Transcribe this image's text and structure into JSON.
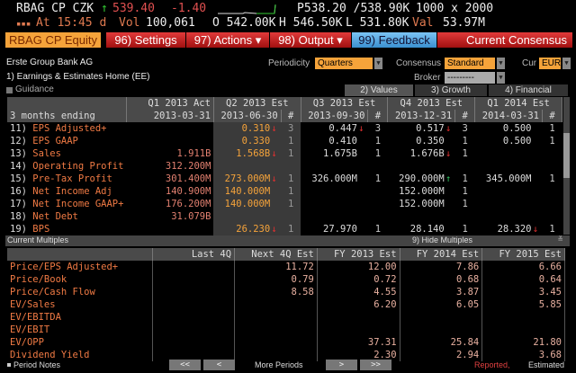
{
  "quote": {
    "ticker": "RBAG CP CZK",
    "last": "539.40",
    "change": "-1.40",
    "bid_ask": "P538.20 /538.90K",
    "size": "1000 x 2000",
    "time": "At 15:45 d",
    "vol_label": "Vol",
    "vol": "100,061",
    "open": "O 542.00K",
    "high": "H 546.50K",
    "low": "L 531.80K",
    "val_label": "Val",
    "val": "53.97M"
  },
  "toolbar": {
    "security": "RBAG CP Equity",
    "settings": "96) Settings",
    "actions": "97) Actions ▾",
    "output": "98) Output ▾",
    "feedback": "99) Feedback",
    "title": "Current Consensus"
  },
  "company": "Erste Group Bank AG",
  "home_link": "1) Earnings & Estimates Home (EE)",
  "filters": {
    "periodicity_label": "Periodicity",
    "periodicity": "Quarters",
    "consensus_label": "Consensus",
    "consensus": "Standard",
    "cur_label": "Cur",
    "cur": "EUR",
    "broker_label": "Broker",
    "broker": "---------"
  },
  "guidance": "Guidance",
  "tabs": [
    "2) Values",
    "3) Growth",
    "4) Financial"
  ],
  "estimates": {
    "headers": [
      "",
      "Q1 2013 Act",
      "Q2 2013 Est",
      "Q3 2013 Est",
      "Q4 2013 Est",
      "Q1 2014 Est"
    ],
    "subheaders": [
      "3 months ending",
      "2013-03-31",
      "2013-06-30",
      "#",
      "2013-09-30",
      "#",
      "2013-12-31",
      "#",
      "2014-03-31",
      "#"
    ],
    "rows": [
      {
        "n": "11)",
        "label": "EPS Adjusted+",
        "q1a": "",
        "q2": "0.310",
        "q2d": "down",
        "q2n": "3",
        "q3": "0.447",
        "q3d": "down",
        "q3n": "3",
        "q4": "0.517",
        "q4d": "down",
        "q4n": "3",
        "q14": "0.500",
        "q14d": "",
        "q14n": "1"
      },
      {
        "n": "12)",
        "label": "EPS GAAP",
        "q1a": "",
        "q2": "0.330",
        "q2d": "",
        "q2n": "1",
        "q3": "0.410",
        "q3d": "",
        "q3n": "1",
        "q4": "0.350",
        "q4d": "",
        "q4n": "1",
        "q14": "0.500",
        "q14d": "",
        "q14n": "1"
      },
      {
        "n": "13)",
        "label": "Sales",
        "q1a": "1.911B",
        "q2": "1.568B",
        "q2d": "down",
        "q2n": "1",
        "q3": "1.675B",
        "q3d": "",
        "q3n": "1",
        "q4": "1.676B",
        "q4d": "down",
        "q4n": "1",
        "q14": "",
        "q14d": "",
        "q14n": ""
      },
      {
        "n": "14)",
        "label": "Operating Profit",
        "q1a": "312.200M",
        "q2": "",
        "q2d": "",
        "q2n": "",
        "q3": "",
        "q3d": "",
        "q3n": "",
        "q4": "",
        "q4d": "",
        "q4n": "",
        "q14": "",
        "q14d": "",
        "q14n": ""
      },
      {
        "n": "15)",
        "label": "Pre-Tax Profit",
        "q1a": "301.400M",
        "q2": "273.000M",
        "q2d": "down",
        "q2n": "1",
        "q3": "326.000M",
        "q3d": "",
        "q3n": "1",
        "q4": "290.000M",
        "q4d": "up",
        "q4n": "1",
        "q14": "345.000M",
        "q14d": "",
        "q14n": "1"
      },
      {
        "n": "16)",
        "label": "Net Income Adj",
        "q1a": "140.900M",
        "q2": "140.000M",
        "q2d": "",
        "q2n": "1",
        "q3": "",
        "q3d": "",
        "q3n": "",
        "q4": "152.000M",
        "q4d": "",
        "q4n": "1",
        "q14": "",
        "q14d": "",
        "q14n": ""
      },
      {
        "n": "17)",
        "label": "Net Income GAAP+",
        "q1a": "176.200M",
        "q2": "140.000M",
        "q2d": "",
        "q2n": "1",
        "q3": "",
        "q3d": "",
        "q3n": "",
        "q4": "152.000M",
        "q4d": "",
        "q4n": "1",
        "q14": "",
        "q14d": "",
        "q14n": ""
      },
      {
        "n": "18)",
        "label": "Net Debt",
        "q1a": "31.079B",
        "q2": "",
        "q2d": "",
        "q2n": "",
        "q3": "",
        "q3d": "",
        "q3n": "",
        "q4": "",
        "q4d": "",
        "q4n": "",
        "q14": "",
        "q14d": "",
        "q14n": ""
      },
      {
        "n": "19)",
        "label": "BPS",
        "q1a": "",
        "q2": "26.230",
        "q2d": "down",
        "q2n": "1",
        "q3": "27.970",
        "q3d": "",
        "q3n": "1",
        "q4": "28.140",
        "q4d": "",
        "q4n": "1",
        "q14": "28.320",
        "q14d": "down",
        "q14n": "1"
      }
    ]
  },
  "multiples": {
    "title": "Current Multiples",
    "hide": "9) Hide Multiples",
    "headers": [
      "",
      "Last 4Q",
      "Next 4Q Est",
      "FY 2013 Est",
      "FY 2014 Est",
      "FY 2015 Est"
    ],
    "rows": [
      [
        "Price/EPS Adjusted+",
        "",
        "11.72",
        "12.00",
        "7.86",
        "6.66"
      ],
      [
        "Price/Book",
        "",
        "0.79",
        "0.72",
        "0.68",
        "0.64"
      ],
      [
        "Price/Cash Flow",
        "",
        "8.58",
        "4.55",
        "3.87",
        "3.45"
      ],
      [
        "EV/Sales",
        "",
        "",
        "6.20",
        "6.05",
        "5.85"
      ],
      [
        "EV/EBITDA",
        "",
        "",
        "",
        "",
        ""
      ],
      [
        "EV/EBIT",
        "",
        "",
        "",
        "",
        ""
      ],
      [
        "EV/OPP",
        "",
        "",
        "37.31",
        "25.84",
        "21.80"
      ],
      [
        "Dividend Yield",
        "",
        "",
        "2.30",
        "2.94",
        "3.68"
      ]
    ]
  },
  "footer": {
    "period_notes": "Period Notes",
    "first": "<<",
    "prev": "<",
    "more": "More Periods",
    "next": ">",
    "last": ">>",
    "reported": "Reported,",
    "estimated": "Estimated"
  },
  "colors": {
    "toolbar_red": "#c01818",
    "accent_orange": "#f5a33a",
    "feedback_blue": "#4aa8e8"
  }
}
